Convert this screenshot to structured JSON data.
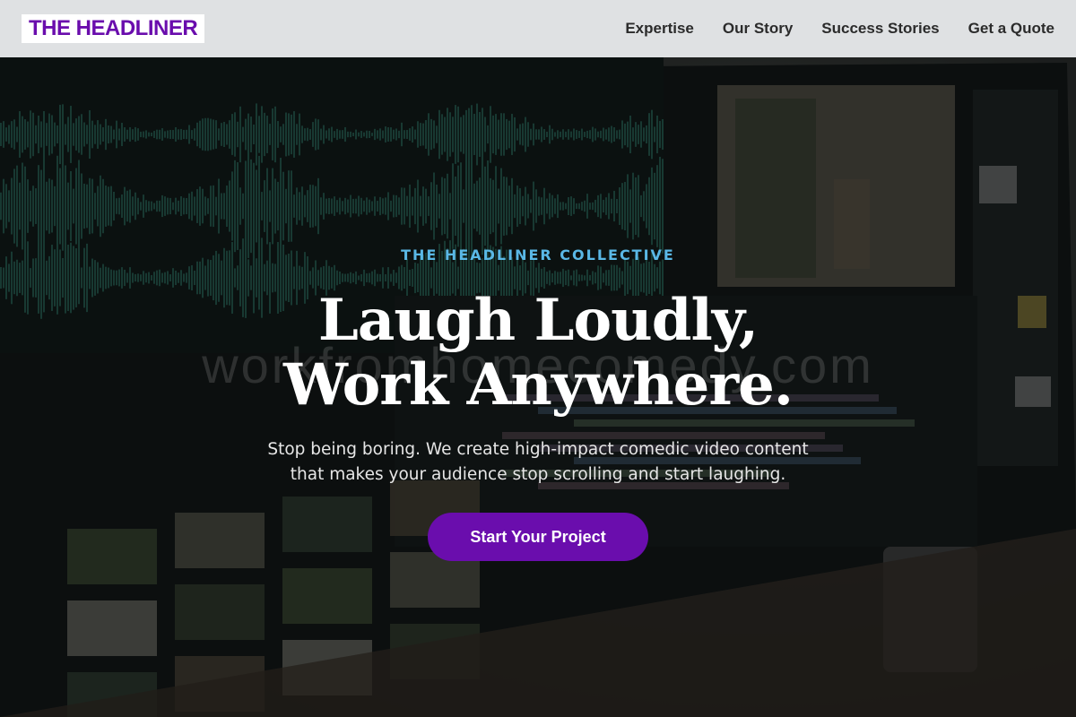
{
  "brand": {
    "logo_text": "THE HEADLINER",
    "logo_color": "#6a0dad",
    "accent_color": "#5ab8e6"
  },
  "nav": {
    "items": [
      {
        "label": "Expertise"
      },
      {
        "label": "Our Story"
      },
      {
        "label": "Success Stories"
      },
      {
        "label": "Get a Quote"
      }
    ]
  },
  "hero": {
    "eyebrow": "THE HEADLINER COLLECTIVE",
    "headline_line1": "Laugh Loudly,",
    "headline_line2": "Work Anywhere.",
    "subtext_line1": "Stop being boring. We create high-impact comedic video content",
    "subtext_line2": "that makes your audience stop scrolling and start laughing.",
    "cta_label": "Start Your Project",
    "watermark": "workfromhomecomedy.com",
    "background_image": "video-editing-monitor-photo"
  }
}
